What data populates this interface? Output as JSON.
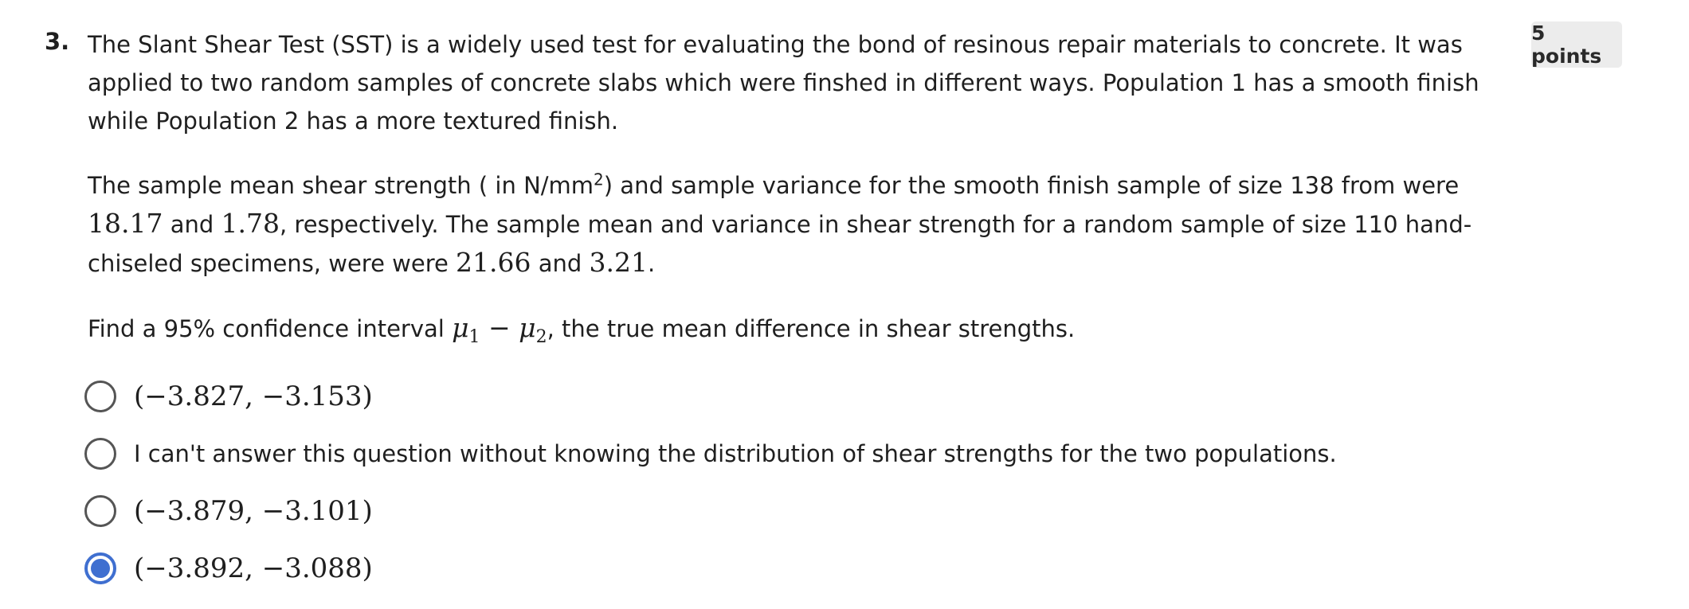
{
  "question": {
    "number": "3.",
    "points": "5 points",
    "paragraph1": "The Slant Shear Test (SST) is a widely used test for evaluating the bond of resinous repair materials to concrete. It was applied to two random samples of concrete slabs which were finshed in different ways. Population 1 has a smooth finish while Population 2  has a more textured finish.",
    "paragraph2": {
      "t1": "The sample mean shear strength ( in N/mm",
      "sup": "2",
      "t2": ") and sample variance for the smooth finish sample of size  138 from were ",
      "v1": "18.17",
      "t3": " and ",
      "v2": "1.78",
      "t4": ", respectively. The sample mean and variance in shear strength for a random sample of size 110 hand-chiseled specimens, were were ",
      "v3": "21.66",
      "t5": " and ",
      "v4": "3.21",
      "t6": "."
    },
    "paragraph3": {
      "t1": "Find a 95% confidence interval ",
      "mu": "μ",
      "sub1": "1",
      "minus": " − ",
      "sub2": "2",
      "t2": ", the true mean difference in shear strengths."
    },
    "options": [
      {
        "label": "(−3.827, −3.153)",
        "selected": false,
        "math": true
      },
      {
        "label": "I can't answer this question without knowing the distribution of shear strengths for the two populations.",
        "selected": false,
        "math": false
      },
      {
        "label": "(−3.879, −3.101)",
        "selected": false,
        "math": true
      },
      {
        "label": "(−3.892, −3.088)",
        "selected": true,
        "math": true
      }
    ]
  },
  "colors": {
    "accent": "#3f6fd0",
    "badge_bg": "#ececec",
    "text": "#1f1f1f"
  }
}
